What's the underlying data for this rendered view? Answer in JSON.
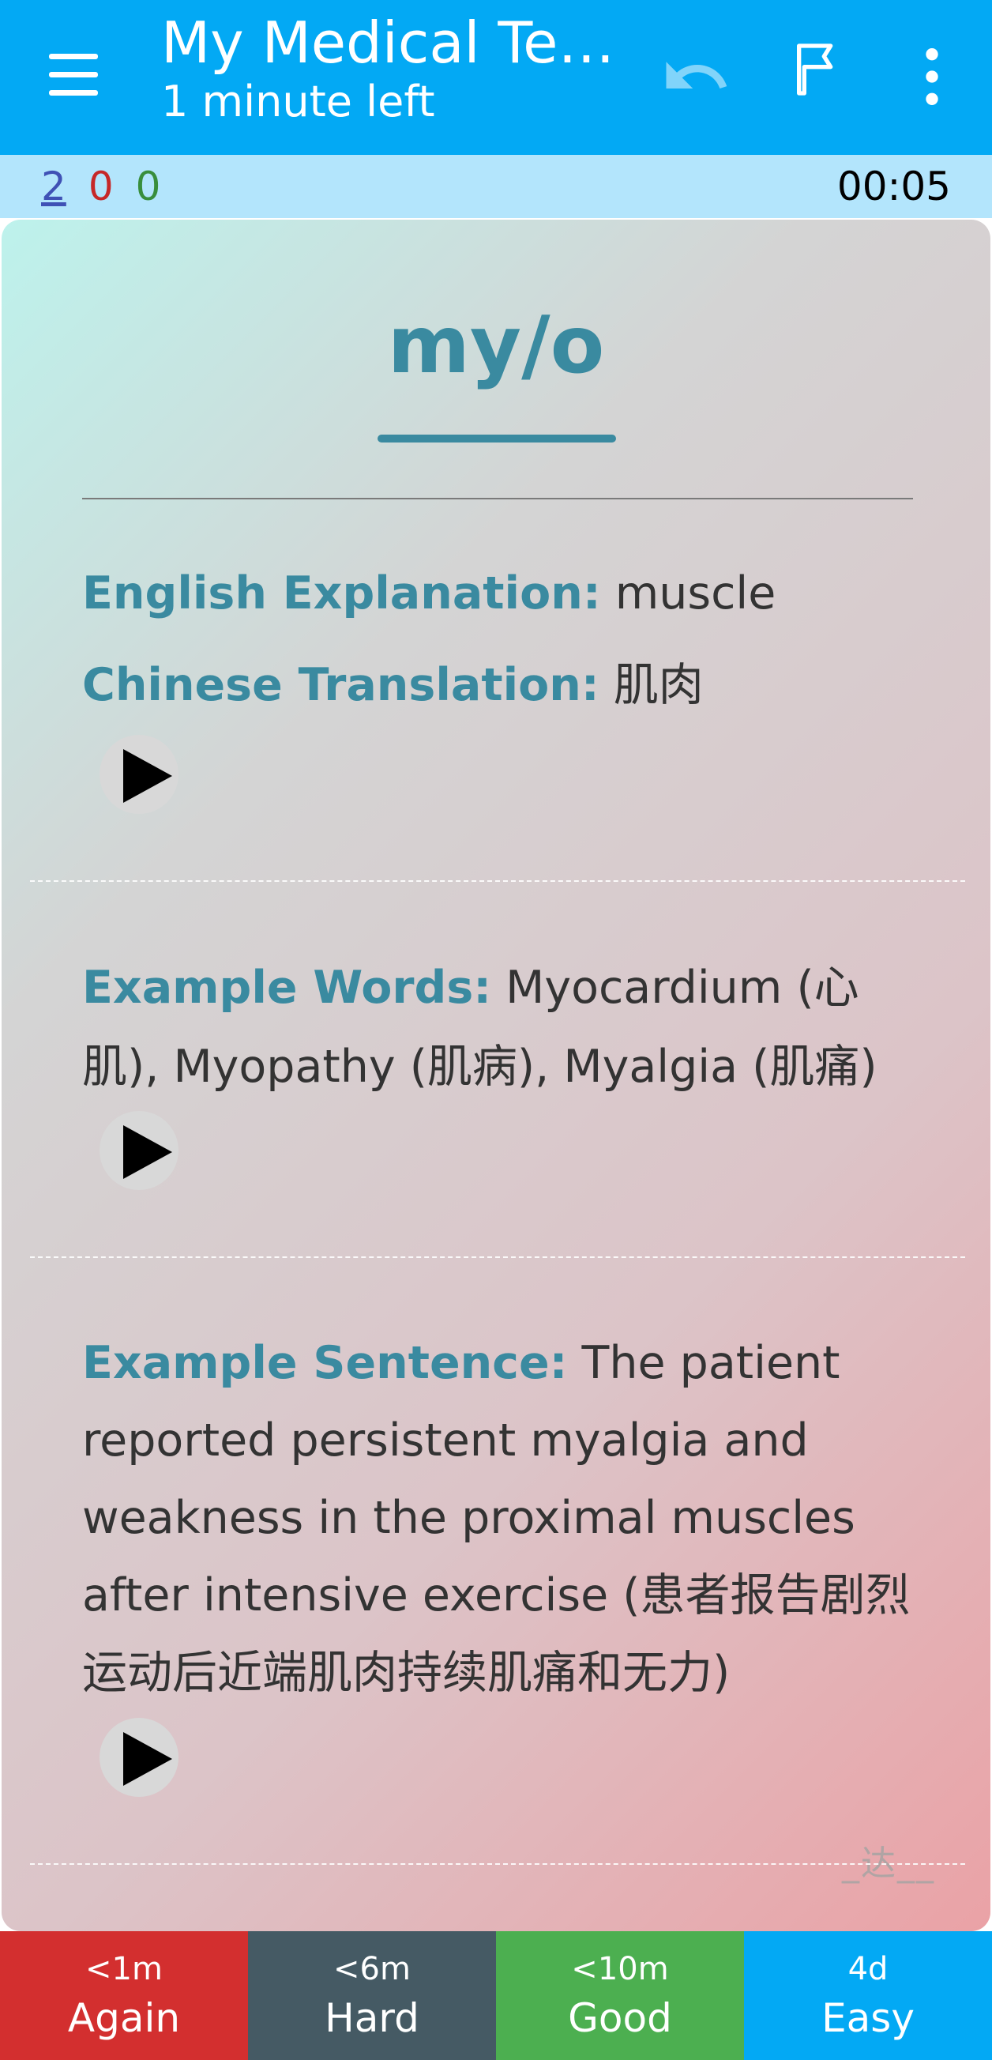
{
  "app": {
    "title": "My Medical Ter…",
    "subtitle": "1 minute left"
  },
  "icons": {
    "menu": "menu-icon",
    "undo": "undo-icon",
    "flag": "flag-icon",
    "more": "more-vert-icon",
    "play": "play-icon"
  },
  "counts": {
    "new": "2",
    "learning": "0",
    "review": "0",
    "timer": "00:05"
  },
  "card": {
    "word": "my/o",
    "english_label": "English Explanation:",
    "english_value": " muscle",
    "chinese_label": "Chinese Translation:",
    "chinese_value": " 肌肉",
    "examples_label": "Example Words:",
    "examples_value": " Myocardium (心肌), Myopathy (肌病), Myalgia (肌痛)",
    "sentence_label": "Example Sentence:",
    "sentence_value": " The patient reported persistent myalgia and weakness in the proximal muscles after intensive exercise (患者报告剧烈运动后近端肌肉持续肌痛和无力)",
    "signature": "_达__"
  },
  "answers": [
    {
      "time": "<1m",
      "label": "Again"
    },
    {
      "time": "<6m",
      "label": "Hard"
    },
    {
      "time": "<10m",
      "label": "Good"
    },
    {
      "time": "4d",
      "label": "Easy"
    }
  ],
  "colors": {
    "appbar": "#03a9f4",
    "countbar": "#b3e5fc",
    "label_teal": "#3a8aa0",
    "again": "#d32f2f",
    "hard": "#455a64",
    "good": "#4caf50",
    "easy": "#03a9f4"
  }
}
